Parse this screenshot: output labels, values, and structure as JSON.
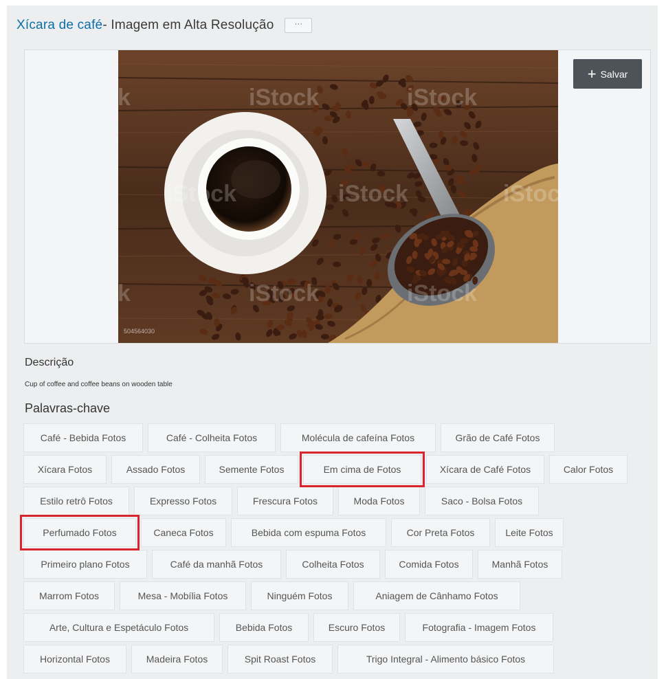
{
  "title": {
    "link_text": "Xícara de café",
    "rest_text": " - Imagem em Alta Resolução",
    "more_label": "···"
  },
  "image": {
    "watermark": "iStock",
    "id_label": "504564030",
    "save_label": "Salvar",
    "colors": {
      "wood_dark": "#3b2417",
      "wood_light": "#7a4f33",
      "bean": "#3a1d10",
      "saucer": "#f3f2ef",
      "coffee": "#1a0f08",
      "burlap": "#c49a5c",
      "scoop": "#a9a9a9"
    }
  },
  "description": {
    "heading": "Descrição",
    "text": "Cup of coffee and coffee beans on wooden table"
  },
  "keywords": {
    "heading": "Palavras-chave",
    "rows": [
      [
        {
          "label": "Café - Bebida Fotos",
          "hl": false
        },
        {
          "label": "Café - Colheita Fotos",
          "hl": false
        },
        {
          "label": "Molécula de cafeína Fotos",
          "hl": false
        },
        {
          "label": "Grão de Café Fotos",
          "hl": false
        }
      ],
      [
        {
          "label": "Xícara Fotos",
          "hl": false
        },
        {
          "label": "Assado Fotos",
          "hl": false
        },
        {
          "label": "Semente Fotos",
          "hl": false
        },
        {
          "label": "Em cima de Fotos",
          "hl": true
        },
        {
          "label": "Xícara de Café Fotos",
          "hl": false
        },
        {
          "label": "Calor Fotos",
          "hl": false
        }
      ],
      [
        {
          "label": "Estilo retrô Fotos",
          "hl": false
        },
        {
          "label": "Expresso Fotos",
          "hl": false
        },
        {
          "label": "Frescura Fotos",
          "hl": false
        },
        {
          "label": "Moda Fotos",
          "hl": false
        },
        {
          "label": "Saco - Bolsa Fotos",
          "hl": false
        }
      ],
      [
        {
          "label": "Perfumado Fotos",
          "hl": true
        },
        {
          "label": "Caneca Fotos",
          "hl": false
        },
        {
          "label": "Bebida com espuma Fotos",
          "hl": false
        },
        {
          "label": "Cor Preta Fotos",
          "hl": false
        },
        {
          "label": "Leite Fotos",
          "hl": false
        }
      ],
      [
        {
          "label": "Primeiro plano Fotos",
          "hl": false
        },
        {
          "label": "Café da manhã Fotos",
          "hl": false
        },
        {
          "label": "Colheita Fotos",
          "hl": false
        },
        {
          "label": "Comida Fotos",
          "hl": false
        },
        {
          "label": "Manhã Fotos",
          "hl": false
        }
      ],
      [
        {
          "label": "Marrom Fotos",
          "hl": false
        },
        {
          "label": "Mesa - Mobília Fotos",
          "hl": false
        },
        {
          "label": "Ninguém Fotos",
          "hl": false
        },
        {
          "label": "Aniagem de Cânhamo Fotos",
          "hl": false
        }
      ],
      [
        {
          "label": "Arte, Cultura e Espetáculo Fotos",
          "hl": false
        },
        {
          "label": "Bebida Fotos",
          "hl": false
        },
        {
          "label": "Escuro Fotos",
          "hl": false
        },
        {
          "label": "Fotografia - Imagem Fotos",
          "hl": false
        }
      ],
      [
        {
          "label": "Horizontal Fotos",
          "hl": false
        },
        {
          "label": "Madeira Fotos",
          "hl": false
        },
        {
          "label": "Spit Roast Fotos",
          "hl": false
        },
        {
          "label": "Trigo Integral - Alimento básico Fotos",
          "hl": false
        }
      ]
    ]
  }
}
